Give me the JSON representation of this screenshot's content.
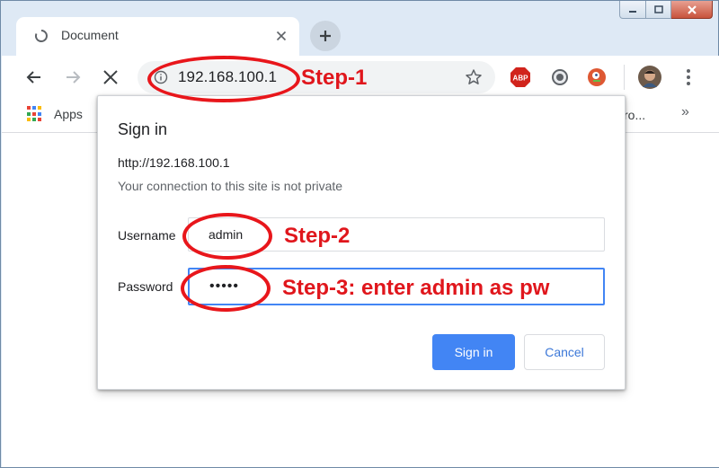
{
  "tab": {
    "title": "Document"
  },
  "omnibox": {
    "url": "192.168.100.1"
  },
  "bookmarks": {
    "apps_label": "Apps",
    "partial_label": "ro...",
    "more_label": "»"
  },
  "extensions": {
    "abp_label": "ABP"
  },
  "dialog": {
    "title": "Sign in",
    "url": "http://192.168.100.1",
    "note": "Your connection to this site is not private",
    "username_label": "Username",
    "username_value": "admin",
    "password_label": "Password",
    "password_value": "•••••",
    "signin_label": "Sign in",
    "cancel_label": "Cancel"
  },
  "annotations": {
    "step1": "Step-1",
    "step2": "Step-2",
    "step3": "Step-3: enter admin as pw"
  },
  "colors": {
    "accent": "#4285f4",
    "annotation": "#e0161c"
  }
}
